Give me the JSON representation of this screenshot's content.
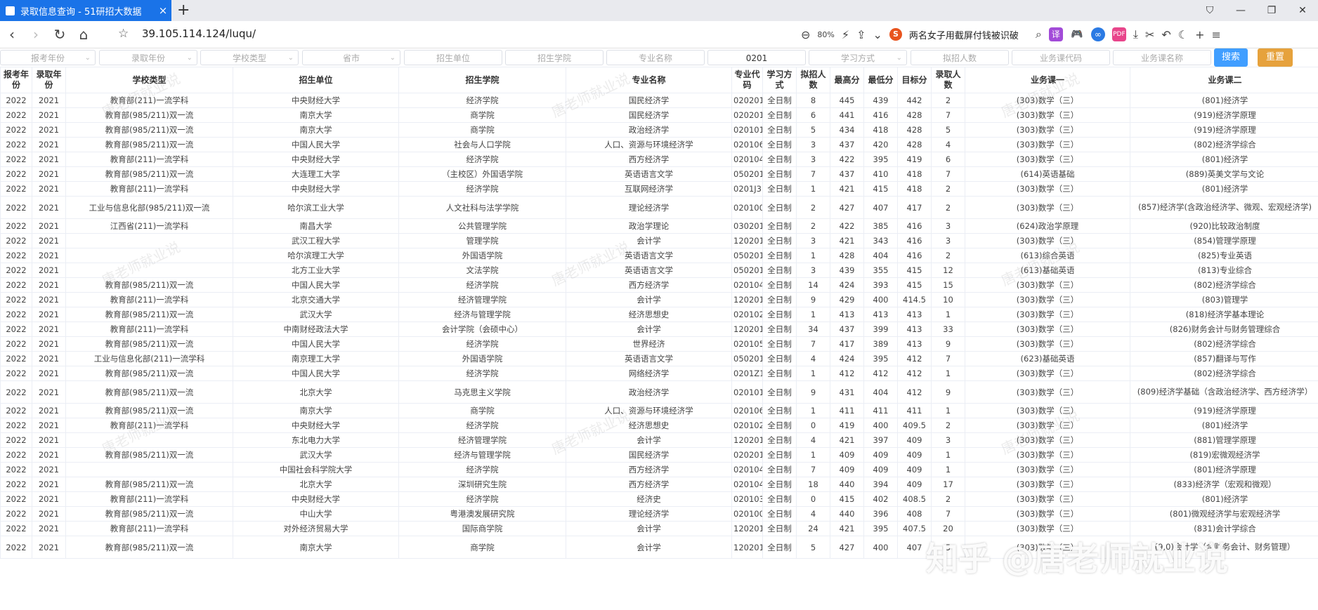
{
  "browser": {
    "tab_title": "录取信息查询 - 51研招大数据",
    "tab_close": "×",
    "new_tab": "+",
    "url": "39.105.114.124/luqu/",
    "zoom": "80%",
    "news": "两名女子用截屏付钱被识破",
    "ext_translate": "译",
    "ext_game": "🎮",
    "ext_other": "∞",
    "ext_pdf": "PDF"
  },
  "filters": {
    "exam_year": "报考年份",
    "admit_year": "录取年份",
    "school_type": "学校类型",
    "province": "省市",
    "unit": "招生单位",
    "college": "招生学院",
    "major_name": "专业名称",
    "major_code_value": "0201",
    "study_mode": "学习方式",
    "plan_count": "拟招人数",
    "course_code": "业务课代码",
    "course_name": "业务课名称",
    "search_button": "搜索",
    "reset_button": "重置"
  },
  "table": {
    "headers": [
      "报考年份",
      "录取年份",
      "学校类型",
      "招生单位",
      "招生学院",
      "专业名称",
      "专业代码",
      "学习方式",
      "拟招人数",
      "最高分",
      "最低分",
      "目标分",
      "录取人数",
      "业务课一",
      "业务课二"
    ],
    "rows": [
      [
        "2022",
        "2021",
        "教育部(211)一流学科",
        "中央财经大学",
        "经济学院",
        "国民经济学",
        "020201",
        "全日制",
        "8",
        "445",
        "439",
        "442",
        "2",
        "(303)数学（三）",
        "(801)经济学"
      ],
      [
        "2022",
        "2021",
        "教育部(985/211)双一流",
        "南京大学",
        "商学院",
        "国民经济学",
        "020201",
        "全日制",
        "6",
        "441",
        "416",
        "428",
        "7",
        "(303)数学（三）",
        "(919)经济学原理"
      ],
      [
        "2022",
        "2021",
        "教育部(985/211)双一流",
        "南京大学",
        "商学院",
        "政治经济学",
        "020101",
        "全日制",
        "5",
        "434",
        "418",
        "428",
        "5",
        "(303)数学（三）",
        "(919)经济学原理"
      ],
      [
        "2022",
        "2021",
        "教育部(985/211)双一流",
        "中国人民大学",
        "社会与人口学院",
        "人口、资源与环境经济学",
        "020106",
        "全日制",
        "3",
        "437",
        "420",
        "428",
        "4",
        "(303)数学（三）",
        "(802)经济学综合"
      ],
      [
        "2022",
        "2021",
        "教育部(211)一流学科",
        "中央财经大学",
        "经济学院",
        "西方经济学",
        "020104",
        "全日制",
        "3",
        "422",
        "395",
        "419",
        "6",
        "(303)数学（三）",
        "(801)经济学"
      ],
      [
        "2022",
        "2021",
        "教育部(985/211)双一流",
        "大连理工大学",
        "（主校区）外国语学院",
        "英语语言文学",
        "050201",
        "全日制",
        "7",
        "437",
        "410",
        "418",
        "7",
        "(614)英语基础",
        "(889)英美文学与文论"
      ],
      [
        "2022",
        "2021",
        "教育部(211)一流学科",
        "中央财经大学",
        "经济学院",
        "互联网经济学",
        "0201J3",
        "全日制",
        "1",
        "421",
        "415",
        "418",
        "2",
        "(303)数学（三）",
        "(801)经济学"
      ],
      [
        "2022",
        "2021",
        "工业与信息化部(985/211)双一流",
        "哈尔滨工业大学",
        "人文社科与法学学院",
        "理论经济学",
        "020100",
        "全日制",
        "2",
        "427",
        "407",
        "417",
        "2",
        "(303)数学（三）",
        "(857)经济学(含政治经济学、微观、宏观经济学)"
      ],
      [
        "2022",
        "2021",
        "江西省(211)一流学科",
        "南昌大学",
        "公共管理学院",
        "政治学理论",
        "030201",
        "全日制",
        "2",
        "422",
        "385",
        "416",
        "3",
        "(624)政治学原理",
        "(920)比较政治制度"
      ],
      [
        "2022",
        "2021",
        "",
        "武汉工程大学",
        "管理学院",
        "会计学",
        "120201",
        "全日制",
        "3",
        "421",
        "343",
        "416",
        "3",
        "(303)数学（三）",
        "(854)管理学原理"
      ],
      [
        "2022",
        "2021",
        "",
        "哈尔滨理工大学",
        "外国语学院",
        "英语语言文学",
        "050201",
        "全日制",
        "1",
        "428",
        "404",
        "416",
        "2",
        "(613)综合英语",
        "(825)专业英语"
      ],
      [
        "2022",
        "2021",
        "",
        "北方工业大学",
        "文法学院",
        "英语语言文学",
        "050201",
        "全日制",
        "3",
        "439",
        "355",
        "415",
        "12",
        "(613)基础英语",
        "(813)专业综合"
      ],
      [
        "2022",
        "2021",
        "教育部(985/211)双一流",
        "中国人民大学",
        "经济学院",
        "西方经济学",
        "020104",
        "全日制",
        "14",
        "424",
        "393",
        "415",
        "15",
        "(303)数学（三）",
        "(802)经济学综合"
      ],
      [
        "2022",
        "2021",
        "教育部(211)一流学科",
        "北京交通大学",
        "经济管理学院",
        "会计学",
        "120201",
        "全日制",
        "9",
        "429",
        "400",
        "414.5",
        "10",
        "(303)数学（三）",
        "(803)管理学"
      ],
      [
        "2022",
        "2021",
        "教育部(985/211)双一流",
        "武汉大学",
        "经济与管理学院",
        "经济思想史",
        "020102",
        "全日制",
        "1",
        "413",
        "413",
        "413",
        "1",
        "(303)数学（三）",
        "(818)经济学基本理论"
      ],
      [
        "2022",
        "2021",
        "教育部(211)一流学科",
        "中南财经政法大学",
        "会计学院（会硕中心）",
        "会计学",
        "120201",
        "全日制",
        "34",
        "437",
        "399",
        "413",
        "33",
        "(303)数学（三）",
        "(826)财务会计与财务管理综合"
      ],
      [
        "2022",
        "2021",
        "教育部(985/211)双一流",
        "中国人民大学",
        "经济学院",
        "世界经济",
        "020105",
        "全日制",
        "7",
        "417",
        "389",
        "413",
        "9",
        "(303)数学（三）",
        "(802)经济学综合"
      ],
      [
        "2022",
        "2021",
        "工业与信息化部(211)一流学科",
        "南京理工大学",
        "外国语学院",
        "英语语言文学",
        "050201",
        "全日制",
        "4",
        "424",
        "395",
        "412",
        "7",
        "(623)基础英语",
        "(857)翻译与写作"
      ],
      [
        "2022",
        "2021",
        "教育部(985/211)双一流",
        "中国人民大学",
        "经济学院",
        "网络经济学",
        "0201Z1",
        "全日制",
        "1",
        "412",
        "412",
        "412",
        "1",
        "(303)数学（三）",
        "(802)经济学综合"
      ],
      [
        "2022",
        "2021",
        "教育部(985/211)双一流",
        "北京大学",
        "马克思主义学院",
        "政治经济学",
        "020101",
        "全日制",
        "9",
        "431",
        "404",
        "412",
        "9",
        "(303)数学（三）",
        "(809)经济学基础（含政治经济学、西方经济学）"
      ],
      [
        "2022",
        "2021",
        "教育部(985/211)双一流",
        "南京大学",
        "商学院",
        "人口、资源与环境经济学",
        "020106",
        "全日制",
        "1",
        "411",
        "411",
        "411",
        "1",
        "(303)数学（三）",
        "(919)经济学原理"
      ],
      [
        "2022",
        "2021",
        "教育部(211)一流学科",
        "中央财经大学",
        "经济学院",
        "经济思想史",
        "020102",
        "全日制",
        "0",
        "419",
        "400",
        "409.5",
        "2",
        "(303)数学（三）",
        "(801)经济学"
      ],
      [
        "2022",
        "2021",
        "",
        "东北电力大学",
        "经济管理学院",
        "会计学",
        "120201",
        "全日制",
        "4",
        "421",
        "397",
        "409",
        "3",
        "(303)数学（三）",
        "(881)管理学原理"
      ],
      [
        "2022",
        "2021",
        "教育部(985/211)双一流",
        "武汉大学",
        "经济与管理学院",
        "国民经济学",
        "020201",
        "全日制",
        "1",
        "409",
        "409",
        "409",
        "1",
        "(303)数学（三）",
        "(819)宏微观经济学"
      ],
      [
        "2022",
        "2021",
        "",
        "中国社会科学院大学",
        "经济学院",
        "西方经济学",
        "020104",
        "全日制",
        "7",
        "409",
        "409",
        "409",
        "1",
        "(303)数学（三）",
        "(801)经济学原理"
      ],
      [
        "2022",
        "2021",
        "教育部(985/211)双一流",
        "北京大学",
        "深圳研究生院",
        "西方经济学",
        "020104",
        "全日制",
        "18",
        "440",
        "394",
        "409",
        "17",
        "(303)数学（三）",
        "(833)经济学（宏观和微观）"
      ],
      [
        "2022",
        "2021",
        "教育部(211)一流学科",
        "中央财经大学",
        "经济学院",
        "经济史",
        "020103",
        "全日制",
        "0",
        "415",
        "402",
        "408.5",
        "2",
        "(303)数学（三）",
        "(801)经济学"
      ],
      [
        "2022",
        "2021",
        "教育部(985/211)双一流",
        "中山大学",
        "粤港澳发展研究院",
        "理论经济学",
        "020100",
        "全日制",
        "4",
        "440",
        "396",
        "408",
        "7",
        "(303)数学（三）",
        "(801)微观经济学与宏观经济学"
      ],
      [
        "2022",
        "2021",
        "教育部(211)一流学科",
        "对外经济贸易大学",
        "国际商学院",
        "会计学",
        "120201",
        "全日制",
        "24",
        "421",
        "395",
        "407.5",
        "20",
        "(303)数学（三）",
        "(831)会计学综合"
      ],
      [
        "2022",
        "2021",
        "教育部(985/211)双一流",
        "南京大学",
        "商学院",
        "会计学",
        "120201",
        "全日制",
        "5",
        "427",
        "400",
        "407",
        "5",
        "(303)数学（三）",
        "(9,0)会计学（含财务会计、财务管理）"
      ]
    ]
  },
  "watermarks": {
    "site": "唐老师就业说",
    "zhihu": "知乎 @唐老师就业说"
  },
  "colors": {
    "tab_active": "#1a73e8",
    "search_button": "#409eff",
    "reset_button": "#e6a23c"
  }
}
